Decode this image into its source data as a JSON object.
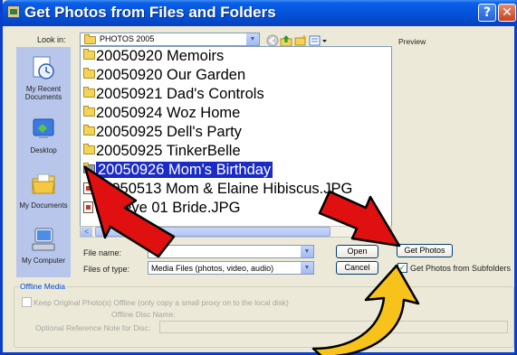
{
  "window": {
    "title": "Get Photos from Files and Folders",
    "help_glyph": "?",
    "close_glyph": "✕"
  },
  "look_in": {
    "label": "Look in:",
    "value": "PHOTOS 2005"
  },
  "preview_label": "Preview",
  "places": [
    {
      "label": "My Recent Documents",
      "icon": "recent-documents-icon"
    },
    {
      "label": "Desktop",
      "icon": "desktop-icon"
    },
    {
      "label": "My Documents",
      "icon": "my-documents-icon"
    },
    {
      "label": "My Computer",
      "icon": "my-computer-icon"
    }
  ],
  "files": [
    {
      "name": "20050920 Memoirs",
      "type": "folder"
    },
    {
      "name": "20050920 Our Garden",
      "type": "folder"
    },
    {
      "name": "20050921 Dad's Controls",
      "type": "folder"
    },
    {
      "name": "20050924 Woz Home",
      "type": "folder"
    },
    {
      "name": "20050925 Dell's Party",
      "type": "folder"
    },
    {
      "name": "20050925 TinkerBelle",
      "type": "folder"
    },
    {
      "name": "20050926 Mom's Birthday",
      "type": "folder",
      "selected": true
    },
    {
      "name": "20050513 Mom & Elaine Hibiscus.JPG",
      "type": "image"
    },
    {
      "name": "Fisheye 01 Bride.JPG",
      "type": "image"
    }
  ],
  "scroll_left_glyph": "<",
  "file_name": {
    "label": "File name:",
    "value": ""
  },
  "files_of_type": {
    "label": "Files of type:",
    "value": "Media Files (photos, video, audio)"
  },
  "buttons": {
    "open": "Open",
    "cancel": "Cancel",
    "get_photos": "Get Photos"
  },
  "subfolders": {
    "label": "Get Photos from Subfolders",
    "checked": true
  },
  "offline": {
    "group_title": "Offline Media",
    "keep_label": "Keep Original Photo(s) Offline (only copy a small proxy on to the local disk)",
    "disc_name_label": "Offline Disc Name:",
    "reference_label": "Optional Reference Note for Disc:"
  },
  "colors": {
    "titlebar": "#0553db",
    "selection": "#1a2bc8",
    "arrow_red": "#e01010",
    "arrow_yellow": "#f7c21a"
  }
}
